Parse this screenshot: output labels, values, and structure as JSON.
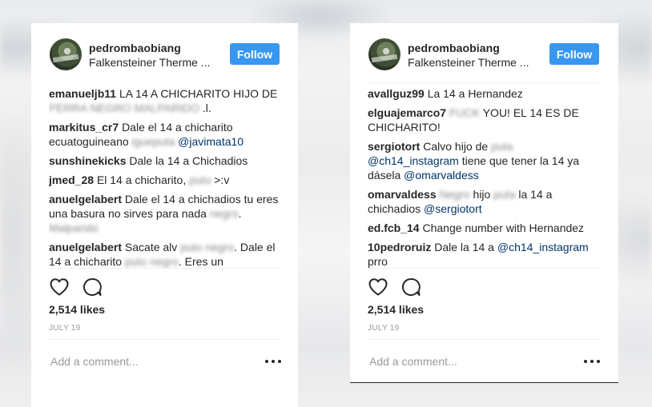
{
  "left_post": {
    "username": "pedrombaobiang",
    "location": "Falkensteiner Therme ...",
    "follow_label": "Follow",
    "comments": [
      {
        "user": "emanueljb11",
        "parts": [
          {
            "t": "LA 14 A CHICHARITO HIJO DE "
          },
          {
            "t": "PERRA NEGRO MALPARIDO",
            "blur": true
          },
          {
            "t": " .l."
          }
        ]
      },
      {
        "user": "markitus_cr7",
        "parts": [
          {
            "t": "Dale el 14 a chicharito ecuatoguineano "
          },
          {
            "t": "igueputa",
            "blur": true
          },
          {
            "t": " "
          },
          {
            "t": "@javimata10",
            "mention": true
          }
        ]
      },
      {
        "user": "sunshinekicks",
        "parts": [
          {
            "t": "Dale la 14 a Chichadios"
          }
        ]
      },
      {
        "user": "jmed_28",
        "parts": [
          {
            "t": "El 14 a chicharito, "
          },
          {
            "t": "puto",
            "blur": true
          },
          {
            "t": " >:v"
          }
        ]
      },
      {
        "user": "anuelgelabert",
        "parts": [
          {
            "t": "Dale el 14 a chichadios tu eres una basura no sirves para nada "
          },
          {
            "t": "negro",
            "blur": true
          },
          {
            "t": ". "
          },
          {
            "t": "Malparido",
            "blur": true
          }
        ]
      },
      {
        "user": "anuelgelabert",
        "parts": [
          {
            "t": "Sacate alv "
          },
          {
            "t": "puto negro",
            "blur": true
          },
          {
            "t": ". Dale el 14 a chicharito "
          },
          {
            "t": "puto negro",
            "blur": true
          },
          {
            "t": ". Eres un"
          }
        ]
      }
    ],
    "likes": "2,514 likes",
    "date": "JULY 19",
    "add_comment_placeholder": "Add a comment..."
  },
  "right_post": {
    "username": "pedrombaobiang",
    "location": "Falkensteiner Therme ...",
    "follow_label": "Follow",
    "comments": [
      {
        "user": "avallguz99",
        "parts": [
          {
            "t": "La 14 a Hernandez"
          }
        ]
      },
      {
        "user": "elguajemarco7",
        "parts": [
          {
            "t": "FUCK",
            "blur": true
          },
          {
            "t": " YOU! EL 14 ES DE CHICHARITO!"
          }
        ]
      },
      {
        "user": "sergiotort",
        "parts": [
          {
            "t": "Calvo hijo de "
          },
          {
            "t": "puta",
            "blur": true
          },
          {
            "t": " "
          },
          {
            "t": "@ch14_instagram",
            "mention": true
          },
          {
            "t": " tiene que tener la 14 ya dásela "
          },
          {
            "t": "@omarvaldess",
            "mention": true
          }
        ]
      },
      {
        "user": "omarvaldess",
        "parts": [
          {
            "t": "Negro",
            "blur": true
          },
          {
            "t": " hijo "
          },
          {
            "t": "puta",
            "blur": true
          },
          {
            "t": " la 14 a chichadios "
          },
          {
            "t": "@sergiotort",
            "mention": true
          }
        ]
      },
      {
        "user": "ed.fcb_14",
        "parts": [
          {
            "t": "Change number with Hernandez"
          }
        ]
      },
      {
        "user": "10pedroruiz",
        "parts": [
          {
            "t": "Dale la 14 a "
          },
          {
            "t": "@ch14_instagram",
            "mention": true
          },
          {
            "t": " prro"
          }
        ]
      }
    ],
    "likes": "2,514 likes",
    "date": "JULY 19",
    "add_comment_placeholder": "Add a comment..."
  },
  "icons": {
    "like": "heart-icon",
    "comment": "speech-bubble-icon",
    "more": "more-options-icon"
  },
  "colors": {
    "follow_button": "#3897f0",
    "mention": "#003569",
    "muted": "#999999"
  }
}
